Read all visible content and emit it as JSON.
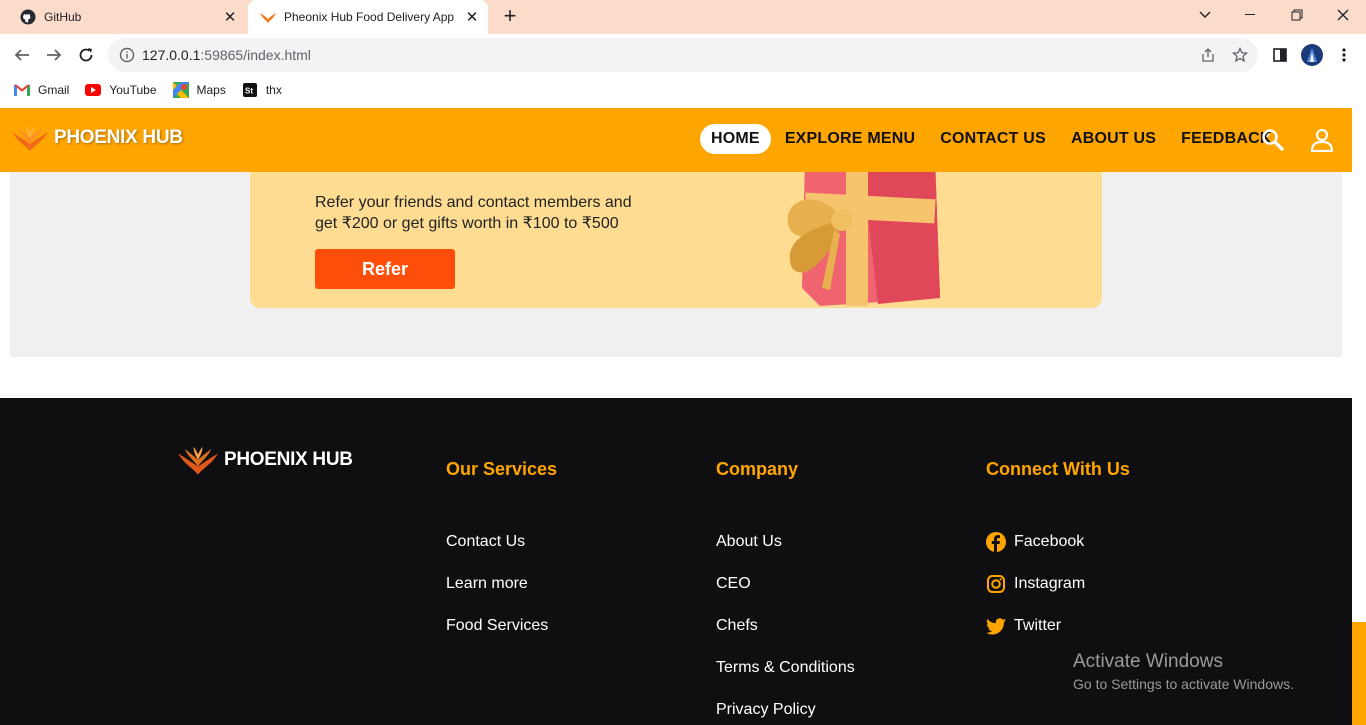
{
  "browser": {
    "tabs": [
      {
        "title": "GitHub",
        "icon": "github-icon",
        "active": false
      },
      {
        "title": "Pheonix Hub Food Delivery App",
        "icon": "phoenix-icon",
        "active": true
      }
    ],
    "new_tab": "+",
    "url_host": "127.0.0.1",
    "url_rest": ":59865/index.html",
    "bookmarks": [
      {
        "label": "Gmail",
        "icon": "gmail-icon"
      },
      {
        "label": "YouTube",
        "icon": "youtube-icon"
      },
      {
        "label": "Maps",
        "icon": "maps-icon"
      },
      {
        "label": "thx",
        "icon": "st-icon"
      }
    ]
  },
  "header": {
    "brand": "PHOENIX HUB",
    "nav": [
      {
        "label": "HOME",
        "active": true
      },
      {
        "label": "EXPLORE MENU",
        "active": false
      },
      {
        "label": "CONTACT US",
        "active": false
      },
      {
        "label": "ABOUT US",
        "active": false
      },
      {
        "label": "FEEDBACK",
        "active": false
      }
    ],
    "accent": "#ffa500"
  },
  "refer": {
    "text_line1": "Refer your friends and contact members and",
    "text_line2": "get ₹200 or get gifts worth in ₹100 to ₹500",
    "button": "Refer",
    "button_color": "#ff4d0a",
    "card_color": "#fedd93"
  },
  "footer": {
    "brand": "PHOENIX HUB",
    "columns": [
      {
        "title": "Our Services",
        "links": [
          "Contact Us",
          "Learn more",
          "Food Services"
        ]
      },
      {
        "title": "Company",
        "links": [
          "About Us",
          "CEO",
          "Chefs",
          "Terms & Conditions",
          "Privacy Policy"
        ]
      },
      {
        "title": "Connect With Us",
        "links": [
          {
            "label": "Facebook",
            "icon": "facebook-icon"
          },
          {
            "label": "Instagram",
            "icon": "instagram-icon"
          },
          {
            "label": "Twitter",
            "icon": "twitter-icon"
          }
        ]
      }
    ]
  },
  "watermark": {
    "line1": "Activate Windows",
    "line2": "Go to Settings to activate Windows."
  }
}
